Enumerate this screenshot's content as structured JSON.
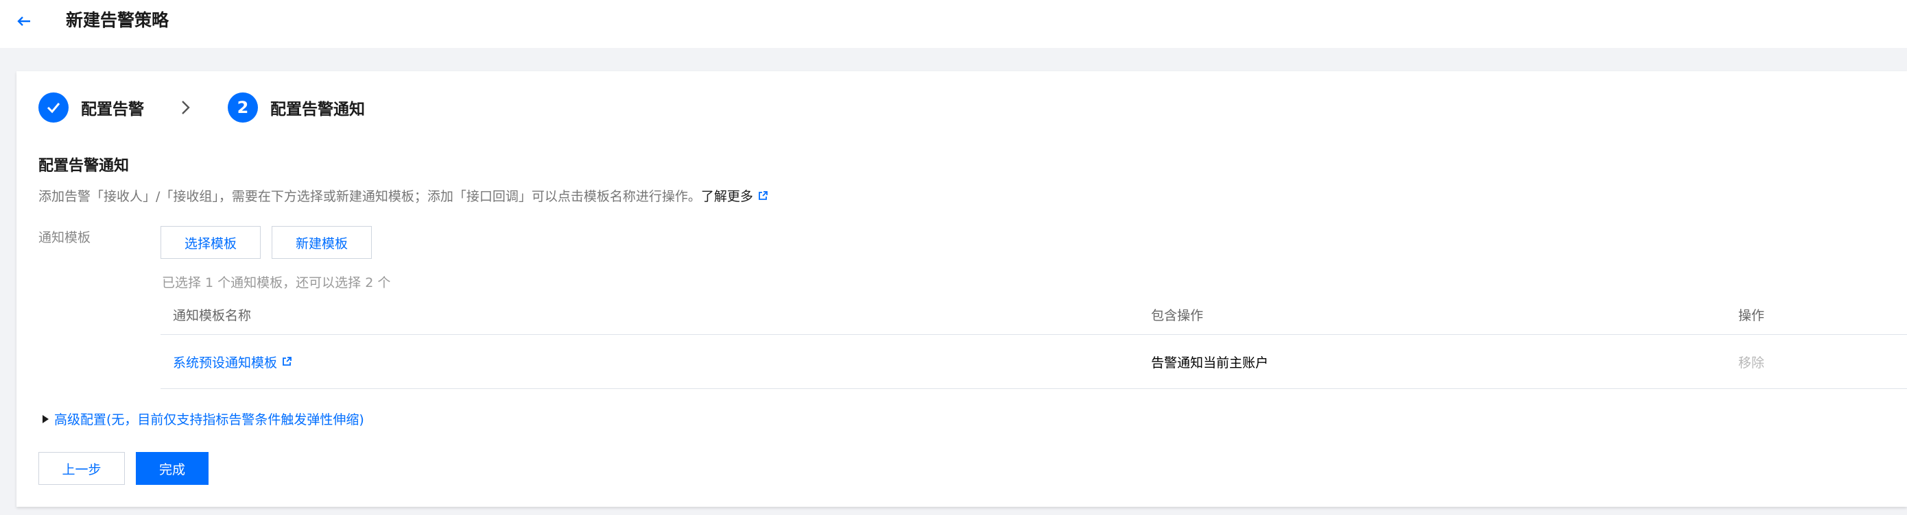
{
  "header": {
    "title": "新建告警策略",
    "back_icon": "arrow-left-icon"
  },
  "steps": [
    {
      "label": "配置告警",
      "status": "done",
      "icon": "check-icon"
    },
    {
      "label": "配置告警通知",
      "status": "current",
      "number": "2"
    }
  ],
  "section": {
    "title": "配置告警通知",
    "description": "添加告警「接收人」/「接收组」，需要在下方选择或新建通知模板；添加「接口回调」可以点击模板名称进行操作。",
    "learn_more": "了解更多"
  },
  "template_field": {
    "label": "通知模板",
    "select_button": "选择模板",
    "new_button": "新建模板",
    "hint": "已选择 1 个通知模板，还可以选择 2 个"
  },
  "table": {
    "columns": [
      "通知模板名称",
      "包含操作",
      "操作"
    ],
    "rows": [
      {
        "name": "系统预设通知模板",
        "operations": "告警通知当前主账户",
        "action": "移除"
      }
    ]
  },
  "advanced": {
    "label": "高级配置(无，目前仅支持指标告警条件触发弹性伸缩)"
  },
  "footer": {
    "prev_button": "上一步",
    "done_button": "完成"
  },
  "colors": {
    "primary": "#006eff",
    "page_bg": "#f2f3f6",
    "muted_text": "#888888"
  }
}
